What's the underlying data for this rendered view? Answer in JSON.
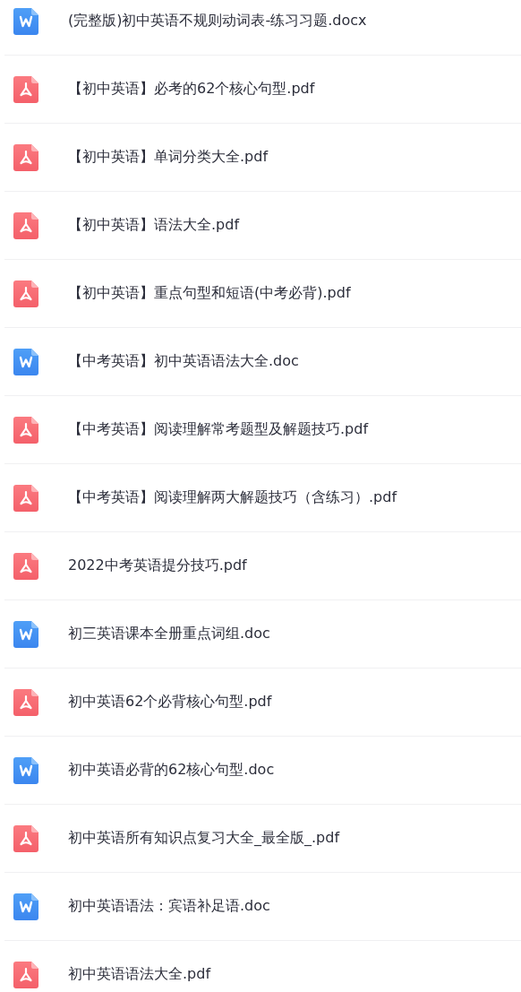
{
  "files": [
    {
      "kind": "word",
      "name": "(完整版)初中英语不规则动词表-练习习题.docx"
    },
    {
      "kind": "pdf",
      "name": "【初中英语】必考的62个核心句型.pdf"
    },
    {
      "kind": "pdf",
      "name": "【初中英语】单词分类大全.pdf"
    },
    {
      "kind": "pdf",
      "name": "【初中英语】语法大全.pdf"
    },
    {
      "kind": "pdf",
      "name": "【初中英语】重点句型和短语(中考必背).pdf"
    },
    {
      "kind": "word",
      "name": "【中考英语】初中英语语法大全.doc"
    },
    {
      "kind": "pdf",
      "name": "【中考英语】阅读理解常考题型及解题技巧.pdf"
    },
    {
      "kind": "pdf",
      "name": "【中考英语】阅读理解两大解题技巧（含练习）.pdf"
    },
    {
      "kind": "pdf",
      "name": "2022中考英语提分技巧.pdf"
    },
    {
      "kind": "word",
      "name": "初三英语课本全册重点词组.doc"
    },
    {
      "kind": "pdf",
      "name": "初中英语62个必背核心句型.pdf"
    },
    {
      "kind": "word",
      "name": "初中英语必背的62核心句型.doc"
    },
    {
      "kind": "pdf",
      "name": "初中英语所有知识点复习大全_最全版_.pdf"
    },
    {
      "kind": "word",
      "name": "初中英语语法：宾语补足语.doc"
    },
    {
      "kind": "pdf",
      "name": "初中英语语法大全.pdf"
    }
  ]
}
